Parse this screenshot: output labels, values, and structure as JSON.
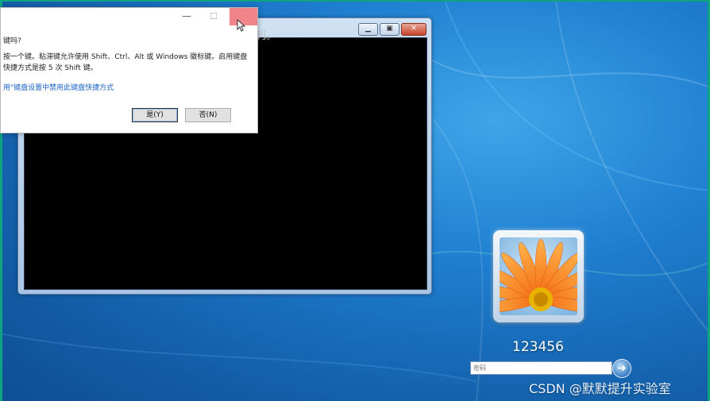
{
  "dialog": {
    "question": "键吗?",
    "description": "按一个键。粘滞键允许使用 Shift、Ctrl、Alt 或 Windows 徽标键。启用键盘快捷方式是按 5 次 Shift 键。",
    "link": "用\"键盘设置中禁用此键盘快捷方式",
    "yes_label": "是(Y)",
    "no_label": "否(N)",
    "minimize_icon": "—",
    "maximize_icon": "☐",
    "close_color": "#f0848a"
  },
  "cmd": {
    "text": "有权利。",
    "minimize_icon": "▁",
    "maximize_icon": "▣",
    "close_icon": "✕"
  },
  "login": {
    "username": "123456",
    "password_placeholder": "密码",
    "submit_icon": "arrow-right-icon",
    "submit_glyph": "➜"
  },
  "watermark": "CSDN @默默提升实验室",
  "colors": {
    "desktop": "#1f7fd1",
    "frame": "#0fa37f",
    "link": "#1a64c8"
  }
}
